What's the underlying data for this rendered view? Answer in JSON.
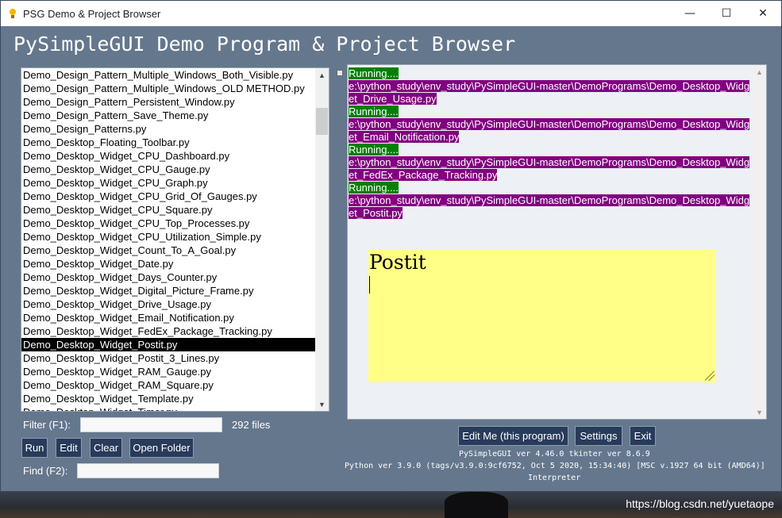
{
  "window": {
    "title": "PSG Demo & Project Browser",
    "controls": {
      "minimize": "—",
      "maximize": "☐",
      "close": "✕"
    }
  },
  "app_title": "PySimpleGUI Demo Program & Project Browser",
  "file_list": {
    "items": [
      "Demo_Design_Pattern_Multiple_Windows_Both_Visible.py",
      "Demo_Design_Pattern_Multiple_Windows_OLD METHOD.py",
      "Demo_Design_Pattern_Persistent_Window.py",
      "Demo_Design_Pattern_Save_Theme.py",
      "Demo_Design_Patterns.py",
      "Demo_Desktop_Floating_Toolbar.py",
      "Demo_Desktop_Widget_CPU_Dashboard.py",
      "Demo_Desktop_Widget_CPU_Gauge.py",
      "Demo_Desktop_Widget_CPU_Graph.py",
      "Demo_Desktop_Widget_CPU_Grid_Of_Gauges.py",
      "Demo_Desktop_Widget_CPU_Square.py",
      "Demo_Desktop_Widget_CPU_Top_Processes.py",
      "Demo_Desktop_Widget_CPU_Utilization_Simple.py",
      "Demo_Desktop_Widget_Count_To_A_Goal.py",
      "Demo_Desktop_Widget_Date.py",
      "Demo_Desktop_Widget_Days_Counter.py",
      "Demo_Desktop_Widget_Digital_Picture_Frame.py",
      "Demo_Desktop_Widget_Drive_Usage.py",
      "Demo_Desktop_Widget_Email_Notification.py",
      "Demo_Desktop_Widget_FedEx_Package_Tracking.py",
      "Demo_Desktop_Widget_Postit.py",
      "Demo_Desktop_Widget_Postit_3_Lines.py",
      "Demo_Desktop_Widget_RAM_Gauge.py",
      "Demo_Desktop_Widget_RAM_Square.py",
      "Demo_Desktop_Widget_Template.py",
      "Demo_Desktop_Widget_Timer.py"
    ],
    "selected_index": 20
  },
  "filter": {
    "label": "Filter (F1):",
    "value": "",
    "count": "292 files"
  },
  "find": {
    "label": "Find (F2):",
    "value": ""
  },
  "buttons": {
    "run": "Run",
    "edit": "Edit",
    "clear": "Clear",
    "open_folder": "Open Folder",
    "edit_me": "Edit Me (this program)",
    "settings": "Settings",
    "exit": "Exit"
  },
  "output": {
    "lines": [
      {
        "type": "run",
        "text": "Running...."
      },
      {
        "type": "path",
        "text": "e:\\python_study\\env_study\\PySimpleGUI-master\\DemoPrograms\\Demo_Desktop_Widg"
      },
      {
        "type": "path",
        "text": "et_Drive_Usage.py"
      },
      {
        "type": "run",
        "text": "Running...."
      },
      {
        "type": "path",
        "text": "e:\\python_study\\env_study\\PySimpleGUI-master\\DemoPrograms\\Demo_Desktop_Widg"
      },
      {
        "type": "path",
        "text": "et_Email_Notification.py"
      },
      {
        "type": "run",
        "text": "Running...."
      },
      {
        "type": "path",
        "text": "e:\\python_study\\env_study\\PySimpleGUI-master\\DemoPrograms\\Demo_Desktop_Widg"
      },
      {
        "type": "path",
        "text": "et_FedEx_Package_Tracking.py"
      },
      {
        "type": "run",
        "text": "Running...."
      },
      {
        "type": "path",
        "text": "e:\\python_study\\env_study\\PySimpleGUI-master\\DemoPrograms\\Demo_Desktop_Widg"
      },
      {
        "type": "path",
        "text": "et_Postit.py"
      }
    ],
    "colors": {
      "running_bg": "#008000",
      "path_bg": "#800080"
    }
  },
  "postit": {
    "title": "Postit",
    "background": "#ffff88"
  },
  "version": {
    "line1": "PySimpleGUI ver 4.46.0  tkinter ver 8.6.9",
    "line2": "Python ver 3.9.0 (tags/v3.9.0:9cf6752, Oct  5 2020, 15:34:40) [MSC v.1927 64 bit (AMD64)]",
    "line3": "Interpreter"
  },
  "watermark": "https://blog.csdn.net/yuetaope",
  "colors": {
    "window_bg": "#64778d",
    "button_bg": "#283b5b"
  }
}
